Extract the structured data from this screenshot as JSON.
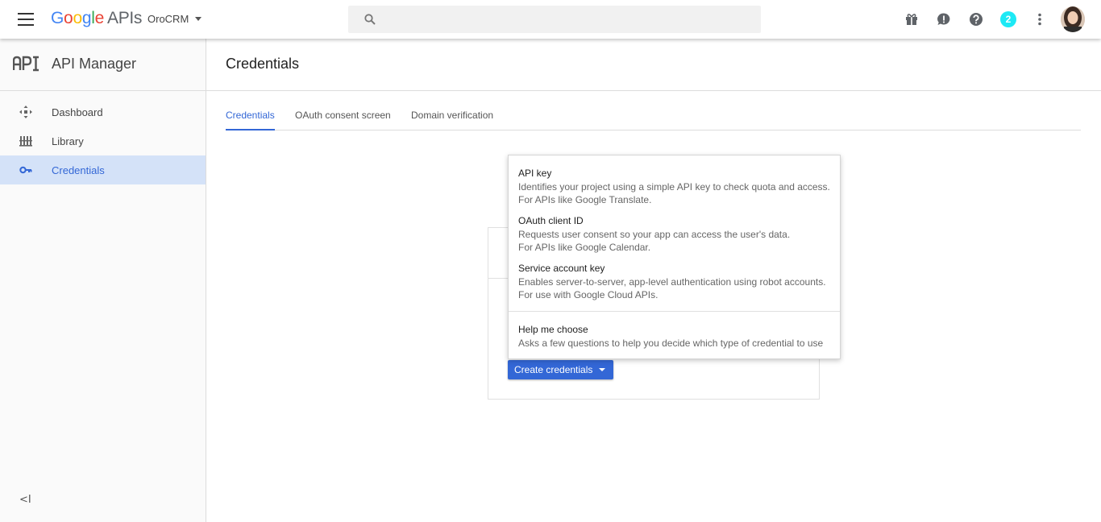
{
  "topbar": {
    "logo_google": [
      "G",
      "o",
      "o",
      "g",
      "l",
      "e"
    ],
    "logo_apis": "APIs",
    "project": "OroCRM",
    "notification_count": "2"
  },
  "sidebar": {
    "title": "API Manager",
    "items": [
      {
        "label": "Dashboard",
        "icon": "dashboard-icon"
      },
      {
        "label": "Library",
        "icon": "library-icon"
      },
      {
        "label": "Credentials",
        "icon": "key-icon",
        "active": true
      }
    ],
    "collapse": "<I"
  },
  "main": {
    "title": "Credentials",
    "tabs": [
      {
        "label": "Credentials",
        "active": true
      },
      {
        "label": "OAuth consent screen"
      },
      {
        "label": "Domain verification"
      }
    ],
    "create_button": "Create credentials"
  },
  "menu": {
    "items": [
      {
        "title": "API key",
        "desc1": "Identifies your project using a simple API key to check quota and access.",
        "desc2": "For APIs like Google Translate."
      },
      {
        "title": "OAuth client ID",
        "desc1": "Requests user consent so your app can access the user's data.",
        "desc2": "For APIs like Google Calendar."
      },
      {
        "title": "Service account key",
        "desc1": "Enables server-to-server, app-level authentication using robot accounts.",
        "desc2": "For use with Google Cloud APIs."
      },
      {
        "title": "Help me choose",
        "desc1": "Asks a few questions to help you decide which type of credential to use"
      }
    ]
  },
  "colors": {
    "accent": "#3367d6",
    "active_nav_bg": "#d4e2f8",
    "badge": "#1de9f5"
  }
}
